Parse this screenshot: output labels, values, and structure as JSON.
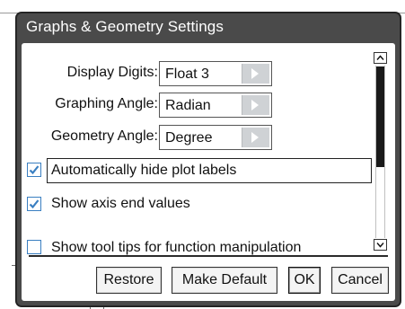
{
  "dialog": {
    "title": "Graphs & Geometry Settings"
  },
  "settings": {
    "display_digits": {
      "label": "Display Digits:",
      "value": "Float 3"
    },
    "graphing_angle": {
      "label": "Graphing Angle:",
      "value": "Radian"
    },
    "geometry_angle": {
      "label": "Geometry Angle:",
      "value": "Degree"
    }
  },
  "options": [
    {
      "label": "Automatically hide plot labels",
      "checked": true
    },
    {
      "label": "Show axis end values",
      "checked": true
    },
    {
      "label": "Show tool tips for function manipulation",
      "checked": false
    }
  ],
  "buttons": {
    "restore": "Restore",
    "make_default": "Make Default",
    "ok": "OK",
    "cancel": "Cancel"
  },
  "colors": {
    "title_bar": "#4a4a4a",
    "checkbox_accent": "#3a7fc1"
  }
}
